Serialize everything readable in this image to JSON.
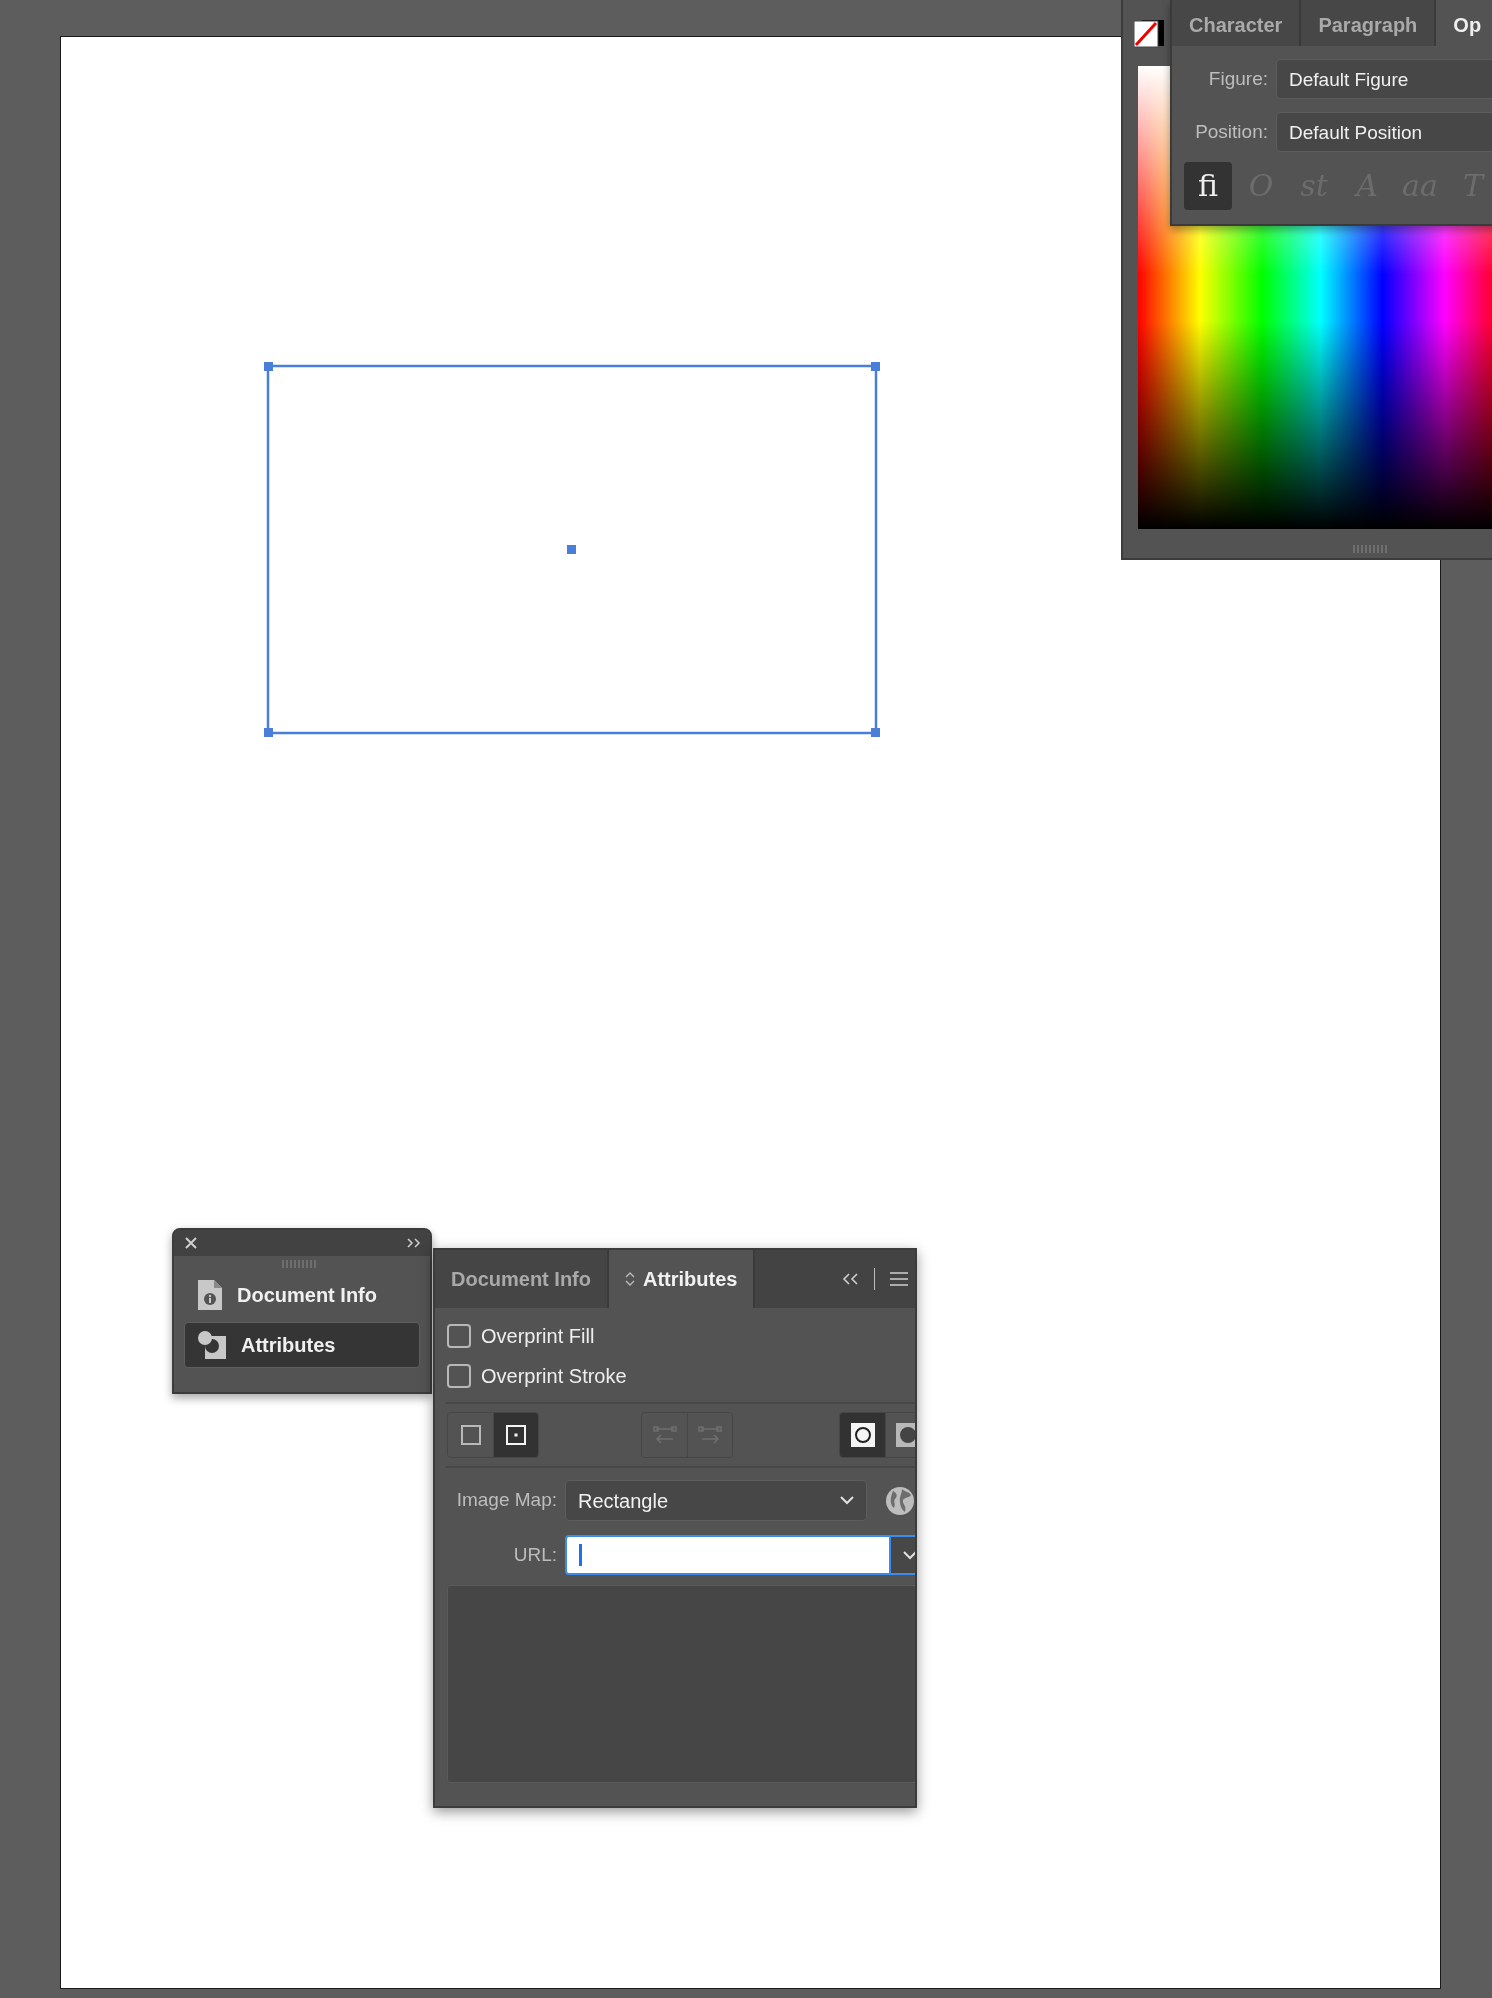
{
  "opentype_panel": {
    "tabs": [
      {
        "label": "Character",
        "selected": false
      },
      {
        "label": "Paragraph",
        "selected": false
      },
      {
        "label": "Op",
        "selected": true
      }
    ],
    "fields": [
      {
        "label": "Figure:",
        "value": "Default Figure"
      },
      {
        "label": "Position:",
        "value": "Default Position"
      }
    ],
    "feature_buttons": [
      {
        "glyph": "ﬁ",
        "selected": true,
        "disabled": false
      },
      {
        "glyph": "O",
        "selected": false,
        "disabled": true
      },
      {
        "glyph": "st",
        "selected": false,
        "disabled": true
      },
      {
        "glyph": "A",
        "selected": false,
        "disabled": true
      },
      {
        "glyph": "aa",
        "selected": false,
        "disabled": true
      },
      {
        "glyph": "T",
        "selected": false,
        "disabled": true
      }
    ]
  },
  "dock": {
    "items": [
      {
        "label": "Document Info",
        "selected": false
      },
      {
        "label": "Attributes",
        "selected": true
      }
    ]
  },
  "attributes_panel": {
    "tabs": [
      {
        "label": "Document Info",
        "selected": false
      },
      {
        "label": "Attributes",
        "selected": true
      }
    ],
    "checkboxes": [
      {
        "label": "Overprint Fill",
        "checked": false
      },
      {
        "label": "Overprint Stroke",
        "checked": false
      }
    ],
    "toggle_groups": [
      {
        "disabled": false,
        "buttons": [
          {
            "selected": false
          },
          {
            "selected": true
          }
        ]
      },
      {
        "disabled": true,
        "buttons": [
          {
            "selected": false
          },
          {
            "selected": false
          }
        ]
      },
      {
        "disabled": false,
        "buttons": [
          {
            "selected": true
          },
          {
            "selected": false
          }
        ]
      }
    ],
    "image_map": {
      "label": "Image Map:",
      "value": "Rectangle"
    },
    "url": {
      "label": "URL:",
      "focused": true
    }
  }
}
